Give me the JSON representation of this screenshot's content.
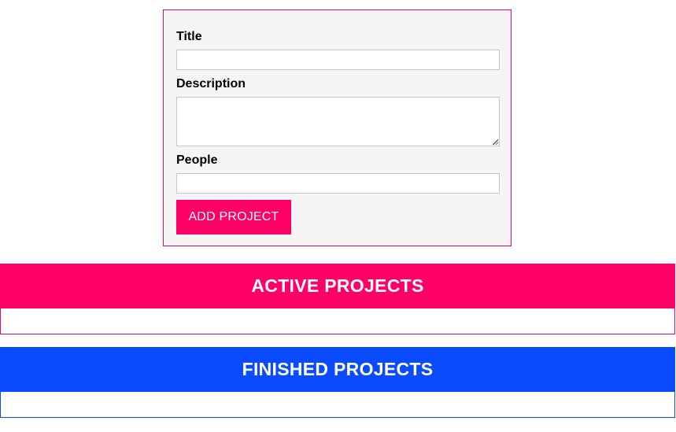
{
  "form": {
    "title_label": "Title",
    "title_value": "",
    "description_label": "Description",
    "description_value": "",
    "people_label": "People",
    "people_value": "",
    "submit_label": "ADD PROJECT"
  },
  "sections": {
    "active": {
      "heading": "ACTIVE PROJECTS",
      "items": [],
      "color": "#ff0066"
    },
    "finished": {
      "heading": "FINISHED PROJECTS",
      "items": [],
      "color": "#0a4bff"
    }
  },
  "colors": {
    "accent": "#ff0066",
    "finished": "#0a4bff",
    "form_background": "#f5f5f5",
    "form_border": "#e0067a"
  },
  "icons": {
    "textarea_resize": "resize-grip-icon"
  }
}
